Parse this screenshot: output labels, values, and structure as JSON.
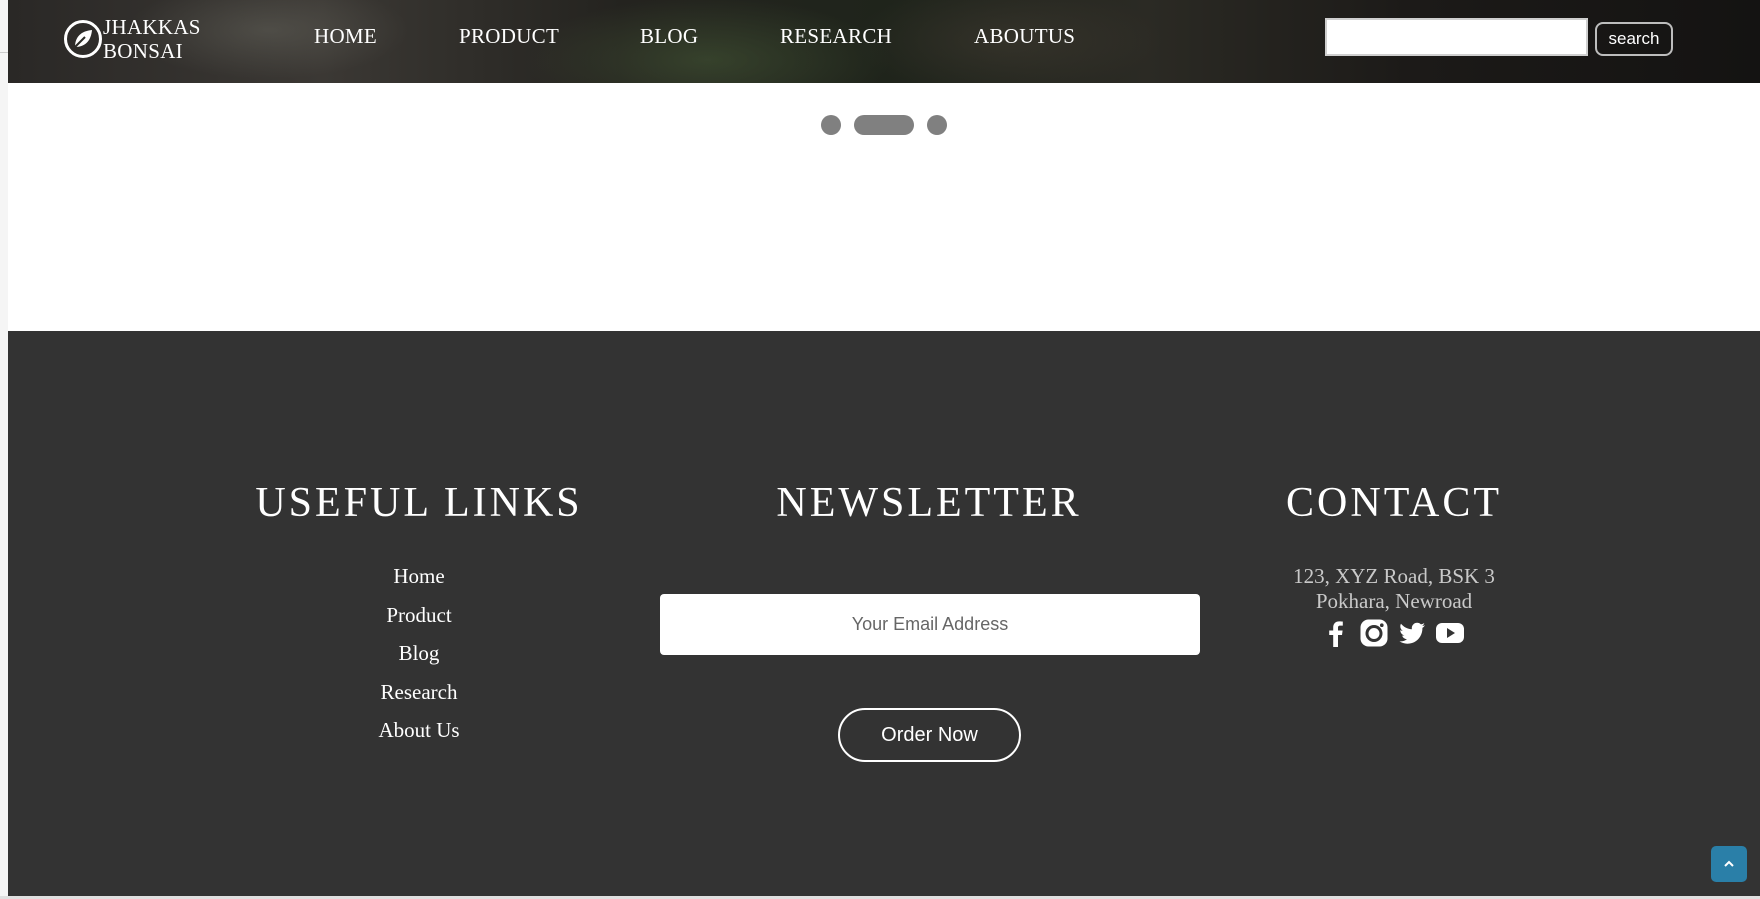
{
  "header": {
    "logo_line1": "JHAKKAS",
    "logo_line2": "BONSAI",
    "nav": {
      "home": "HOME",
      "product": "PRODUCT",
      "blog": "BLOG",
      "research": "RESEARCH",
      "about": "ABOUTUS"
    },
    "search_value": "",
    "search_button": "search"
  },
  "carousel": {
    "indicator_count": 3,
    "active_indicator": 2
  },
  "footer": {
    "useful_links": {
      "title": "USEFUL LINKS",
      "items": [
        "Home",
        "Product",
        "Blog",
        "Research",
        "About Us"
      ]
    },
    "newsletter": {
      "title": "NEWSLETTER",
      "email_placeholder": "Your Email Address",
      "button": "Order Now"
    },
    "contact": {
      "title": "CONTACT",
      "address_line1": "123, XYZ Road, BSK 3",
      "address_line2": "Pokhara, Newroad",
      "social_icons": [
        "facebook-icon",
        "instagram-icon",
        "twitter-icon",
        "youtube-icon"
      ]
    },
    "back_to_top_icon": "chevron-up-icon"
  },
  "colors": {
    "footer_bg": "#333333",
    "indicator": "#808080",
    "back_to_top": "#2a7fa8"
  }
}
